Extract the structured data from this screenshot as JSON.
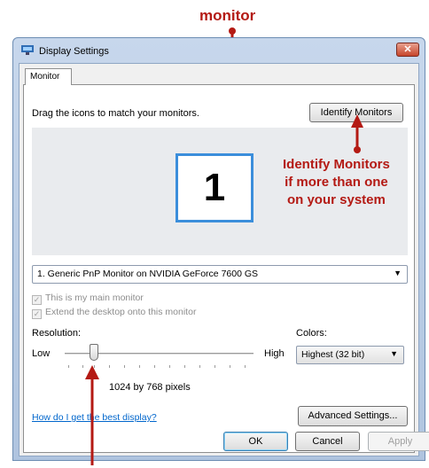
{
  "annotations": {
    "monitor": "monitor",
    "identify_line1": "Identify Monitors",
    "identify_line2": "if more than one",
    "identify_line3": "on your system"
  },
  "window": {
    "title": "Display Settings",
    "close_glyph": "✕"
  },
  "tabs": [
    {
      "label": "Monitor"
    }
  ],
  "monitor_tab": {
    "instruction": "Drag the icons to match your monitors.",
    "identify_button": "Identify Monitors",
    "monitor_number": "1",
    "monitor_select": "1. Generic PnP Monitor on NVIDIA GeForce 7600 GS",
    "main_monitor_checkbox": {
      "label": "This is my main monitor",
      "checked": true,
      "disabled": true
    },
    "extend_checkbox": {
      "label": "Extend the desktop onto this monitor",
      "checked": true,
      "disabled": true
    },
    "resolution": {
      "label": "Resolution:",
      "low": "Low",
      "high": "High",
      "value_text": "1024 by 768 pixels"
    },
    "colors": {
      "label": "Colors:",
      "selected": "Highest (32 bit)"
    },
    "help_link": "How do I get the best display?",
    "advanced_button": "Advanced Settings..."
  },
  "footer": {
    "ok": "OK",
    "cancel": "Cancel",
    "apply": "Apply"
  },
  "colors": {
    "annotation_red": "#b41a14",
    "monitor_border_blue": "#3b8edb",
    "link_blue": "#0066cc"
  },
  "icons": [
    "display-icon",
    "close-icon",
    "dropdown-arrow-icon",
    "checkmark-icon"
  ]
}
